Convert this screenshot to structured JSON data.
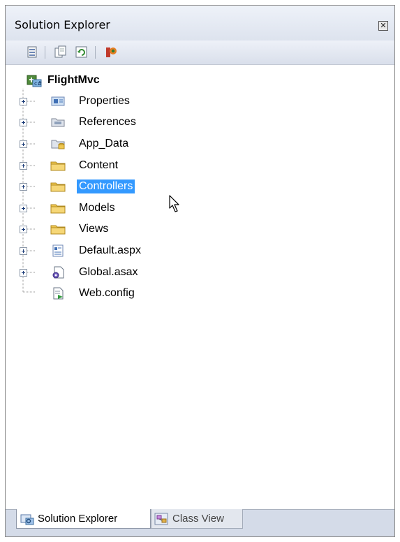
{
  "window": {
    "title": "Solution Explorer",
    "close_glyph": "✕"
  },
  "toolbar": {
    "buttons": [
      {
        "icon": "properties-icon"
      },
      {
        "icon": "show-all-files-icon"
      },
      {
        "icon": "refresh-icon"
      },
      {
        "icon": "class-diagram-icon"
      }
    ]
  },
  "tree": {
    "root": {
      "label": "FlightMvc",
      "icon": "csharp-project-icon"
    },
    "nodes": [
      {
        "label": "Properties",
        "icon": "properties-folder-icon",
        "expandable": true,
        "selected": false
      },
      {
        "label": "References",
        "icon": "references-icon",
        "expandable": true,
        "selected": false
      },
      {
        "label": "App_Data",
        "icon": "app-data-folder-icon",
        "expandable": true,
        "selected": false
      },
      {
        "label": "Content",
        "icon": "folder-icon",
        "expandable": true,
        "selected": false
      },
      {
        "label": "Controllers",
        "icon": "folder-icon",
        "expandable": true,
        "selected": true
      },
      {
        "label": "Models",
        "icon": "folder-icon",
        "expandable": true,
        "selected": false
      },
      {
        "label": "Views",
        "icon": "folder-icon",
        "expandable": true,
        "selected": false
      },
      {
        "label": "Default.aspx",
        "icon": "aspx-file-icon",
        "expandable": true,
        "selected": false
      },
      {
        "label": "Global.asax",
        "icon": "asax-file-icon",
        "expandable": true,
        "selected": false
      },
      {
        "label": "Web.config",
        "icon": "config-file-icon",
        "expandable": false,
        "selected": false
      }
    ]
  },
  "tabs": [
    {
      "label": "Solution Explorer",
      "icon": "solution-explorer-icon",
      "active": true
    },
    {
      "label": "Class View",
      "icon": "class-view-icon",
      "active": false
    }
  ],
  "colors": {
    "selection": "#3399ff",
    "folder": "#f0c850",
    "title_bar": "#dde3ee"
  }
}
